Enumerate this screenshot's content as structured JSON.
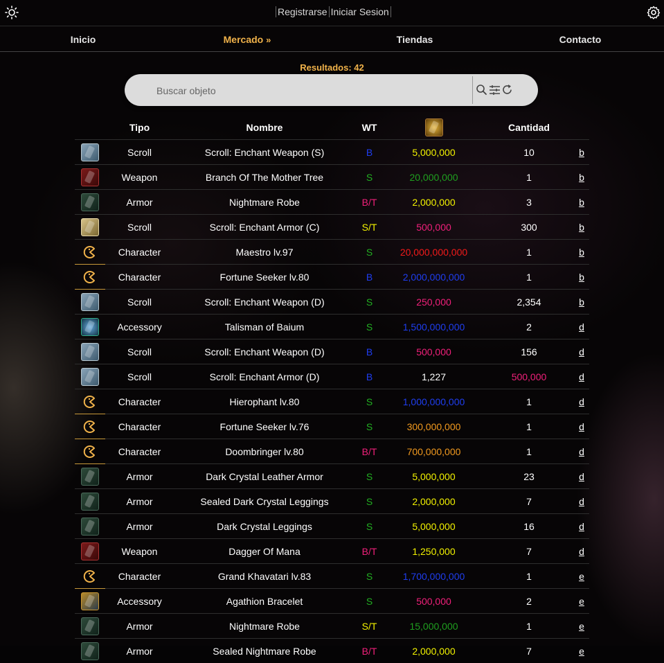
{
  "header": {
    "register_label": "Registrarse",
    "login_label": "Iniciar Sesion"
  },
  "nav": {
    "items": [
      {
        "label": "Inicio"
      },
      {
        "label": "Mercado"
      },
      {
        "label": "Tiendas"
      },
      {
        "label": "Contacto"
      }
    ]
  },
  "results_label": "Resultados: 42",
  "search": {
    "placeholder": "Buscar objeto"
  },
  "table": {
    "headers": {
      "tipo": "Tipo",
      "nombre": "Nombre",
      "wt": "WT",
      "price_icon": "gold-coins-icon",
      "cantidad": "Cantidad"
    },
    "rows": [
      {
        "icon": "scroll",
        "tipo": "Scroll",
        "nombre": "Scroll: Enchant Weapon (S)",
        "wt": "B",
        "wt_color": "#1f3ef0",
        "precio": "5,000,000",
        "precio_color": "#f2f200",
        "cantidad": "10",
        "cantidad_color": "#ffffff",
        "link": "b"
      },
      {
        "icon": "weapon",
        "tipo": "Weapon",
        "nombre": "Branch Of The Mother Tree",
        "wt": "S",
        "wt_color": "#22b022",
        "precio": "20,000,000",
        "precio_color": "#1f9f1f",
        "cantidad": "1",
        "cantidad_color": "#ffffff",
        "link": "b"
      },
      {
        "icon": "armor",
        "tipo": "Armor",
        "nombre": "Nightmare Robe",
        "wt": "B/T",
        "wt_color": "#f0207a",
        "precio": "2,000,000",
        "precio_color": "#f2f200",
        "cantidad": "3",
        "cantidad_color": "#ffffff",
        "link": "b"
      },
      {
        "icon": "scroll-c",
        "tipo": "Scroll",
        "nombre": "Scroll: Enchant Armor (C)",
        "wt": "S/T",
        "wt_color": "#f2f200",
        "precio": "500,000",
        "precio_color": "#f0207a",
        "cantidad": "300",
        "cantidad_color": "#ffffff",
        "link": "b"
      },
      {
        "icon": "character",
        "tipo": "Character",
        "nombre": "Maestro lv.97",
        "wt": "S",
        "wt_color": "#22b022",
        "precio": "20,000,000,000",
        "precio_color": "#f21a1a",
        "cantidad": "1",
        "cantidad_color": "#ffffff",
        "link": "b"
      },
      {
        "icon": "character",
        "tipo": "Character",
        "nombre": "Fortune Seeker lv.80",
        "wt": "B",
        "wt_color": "#1f3ef0",
        "precio": "2,000,000,000",
        "precio_color": "#1f3ef0",
        "cantidad": "1",
        "cantidad_color": "#ffffff",
        "link": "b"
      },
      {
        "icon": "scroll",
        "tipo": "Scroll",
        "nombre": "Scroll: Enchant Weapon (D)",
        "wt": "S",
        "wt_color": "#22b022",
        "precio": "250,000",
        "precio_color": "#f0207a",
        "cantidad": "2,354",
        "cantidad_color": "#ffffff",
        "link": "b"
      },
      {
        "icon": "accessory",
        "tipo": "Accessory",
        "nombre": "Talisman of Baium",
        "wt": "S",
        "wt_color": "#22b022",
        "precio": "1,500,000,000",
        "precio_color": "#1f3ef0",
        "cantidad": "2",
        "cantidad_color": "#ffffff",
        "link": "d"
      },
      {
        "icon": "scroll",
        "tipo": "Scroll",
        "nombre": "Scroll: Enchant Weapon (D)",
        "wt": "B",
        "wt_color": "#1f3ef0",
        "precio": "500,000",
        "precio_color": "#f0207a",
        "cantidad": "156",
        "cantidad_color": "#ffffff",
        "link": "d"
      },
      {
        "icon": "scroll",
        "tipo": "Scroll",
        "nombre": "Scroll: Enchant Armor (D)",
        "wt": "B",
        "wt_color": "#1f3ef0",
        "precio": "1,227",
        "precio_color": "#ffffff",
        "cantidad": "500,000",
        "cantidad_color": "#f0207a",
        "link": "d"
      },
      {
        "icon": "character",
        "tipo": "Character",
        "nombre": "Hierophant lv.80",
        "wt": "S",
        "wt_color": "#22b022",
        "precio": "1,000,000,000",
        "precio_color": "#1f3ef0",
        "cantidad": "1",
        "cantidad_color": "#ffffff",
        "link": "d"
      },
      {
        "icon": "character",
        "tipo": "Character",
        "nombre": "Fortune Seeker lv.76",
        "wt": "S",
        "wt_color": "#22b022",
        "precio": "300,000,000",
        "precio_color": "#f29a1f",
        "cantidad": "1",
        "cantidad_color": "#ffffff",
        "link": "d"
      },
      {
        "icon": "character",
        "tipo": "Character",
        "nombre": "Doombringer lv.80",
        "wt": "B/T",
        "wt_color": "#f0207a",
        "precio": "700,000,000",
        "precio_color": "#f29a1f",
        "cantidad": "1",
        "cantidad_color": "#ffffff",
        "link": "d"
      },
      {
        "icon": "armor",
        "tipo": "Armor",
        "nombre": "Dark Crystal Leather Armor",
        "wt": "S",
        "wt_color": "#22b022",
        "precio": "5,000,000",
        "precio_color": "#f2f200",
        "cantidad": "23",
        "cantidad_color": "#ffffff",
        "link": "d"
      },
      {
        "icon": "armor",
        "tipo": "Armor",
        "nombre": "Sealed Dark Crystal Leggings",
        "wt": "S",
        "wt_color": "#22b022",
        "precio": "2,000,000",
        "precio_color": "#f2f200",
        "cantidad": "7",
        "cantidad_color": "#ffffff",
        "link": "d"
      },
      {
        "icon": "armor",
        "tipo": "Armor",
        "nombre": "Dark Crystal Leggings",
        "wt": "S",
        "wt_color": "#22b022",
        "precio": "5,000,000",
        "precio_color": "#f2f200",
        "cantidad": "16",
        "cantidad_color": "#ffffff",
        "link": "d"
      },
      {
        "icon": "weapon",
        "tipo": "Weapon",
        "nombre": "Dagger Of Mana",
        "wt": "B/T",
        "wt_color": "#f0207a",
        "precio": "1,250,000",
        "precio_color": "#f2f200",
        "cantidad": "7",
        "cantidad_color": "#ffffff",
        "link": "d"
      },
      {
        "icon": "character",
        "tipo": "Character",
        "nombre": "Grand Khavatari lv.83",
        "wt": "S",
        "wt_color": "#22b022",
        "precio": "1,700,000,000",
        "precio_color": "#1f3ef0",
        "cantidad": "1",
        "cantidad_color": "#ffffff",
        "link": "e"
      },
      {
        "icon": "bracelet",
        "tipo": "Accessory",
        "nombre": "Agathion Bracelet",
        "wt": "S",
        "wt_color": "#22b022",
        "precio": "500,000",
        "precio_color": "#f0207a",
        "cantidad": "2",
        "cantidad_color": "#ffffff",
        "link": "e"
      },
      {
        "icon": "armor",
        "tipo": "Armor",
        "nombre": "Nightmare Robe",
        "wt": "S/T",
        "wt_color": "#f2f200",
        "precio": "15,000,000",
        "precio_color": "#1f9f1f",
        "cantidad": "1",
        "cantidad_color": "#ffffff",
        "link": "e"
      },
      {
        "icon": "armor",
        "tipo": "Armor",
        "nombre": "Sealed Nightmare Robe",
        "wt": "B/T",
        "wt_color": "#f0207a",
        "precio": "2,000,000",
        "precio_color": "#f2f200",
        "cantidad": "7",
        "cantidad_color": "#ffffff",
        "link": "e"
      }
    ]
  },
  "colors": {
    "accent": "#f0b24a"
  }
}
